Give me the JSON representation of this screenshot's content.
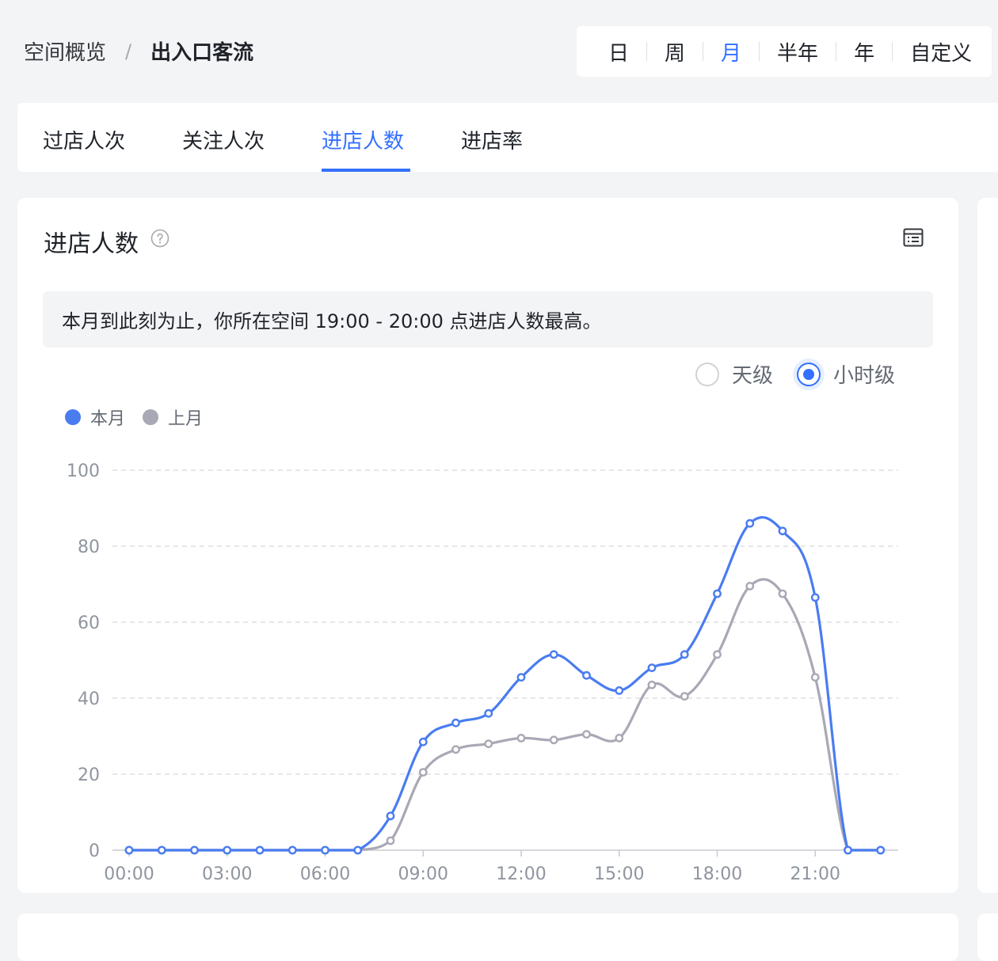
{
  "breadcrumb": {
    "parent": "空间概览",
    "separator": "/",
    "current": "出入口客流"
  },
  "range_switch": {
    "items": [
      "日",
      "周",
      "月",
      "半年",
      "年",
      "自定义"
    ],
    "active": "月"
  },
  "tabs": {
    "items": [
      "过店人次",
      "关注人次",
      "进店人数",
      "进店率"
    ],
    "active": "进店人数"
  },
  "card": {
    "title": "进店人数",
    "help_icon": "question-circle-icon",
    "table_icon": "table-view-icon",
    "insight": "本月到此刻为止，你所在空间 19:00 - 20:00 点进店人数最高。",
    "granularity": {
      "options": [
        "天级",
        "小时级"
      ],
      "selected": "小时级"
    }
  },
  "colors": {
    "accent": "#3370ff",
    "this_month": "#4a7cf0",
    "last_month": "#a9a8b5",
    "grid": "#dcdfe3",
    "axis_text": "#8f959e"
  },
  "chart_data": {
    "type": "line",
    "title": "",
    "xlabel": "",
    "ylabel": "",
    "ylim": [
      0,
      100
    ],
    "yticks": [
      0,
      20,
      40,
      60,
      80,
      100
    ],
    "x": [
      "00:00",
      "01:00",
      "02:00",
      "03:00",
      "04:00",
      "05:00",
      "06:00",
      "07:00",
      "08:00",
      "09:00",
      "10:00",
      "11:00",
      "12:00",
      "13:00",
      "14:00",
      "15:00",
      "16:00",
      "17:00",
      "18:00",
      "19:00",
      "20:00",
      "21:00",
      "22:00",
      "23:00"
    ],
    "xticks": [
      "00:00",
      "03:00",
      "06:00",
      "09:00",
      "12:00",
      "15:00",
      "18:00",
      "21:00"
    ],
    "grid": "horizontal-dashed",
    "legend_position": "top-left",
    "series": [
      {
        "name": "本月",
        "color": "#4a7cf0",
        "values": [
          0,
          0,
          0,
          0,
          0,
          0,
          0,
          0,
          9,
          28.5,
          33.5,
          36,
          45.5,
          51.5,
          46,
          42,
          48,
          51.5,
          67.5,
          86,
          84,
          66.5,
          0,
          0
        ]
      },
      {
        "name": "上月",
        "color": "#a9a8b5",
        "values": [
          0,
          0,
          0,
          0,
          0,
          0,
          0,
          0,
          2.5,
          20.5,
          26.5,
          28,
          29.5,
          29,
          30.5,
          29.5,
          43.5,
          40.5,
          51.5,
          69.5,
          67.5,
          45.5,
          0,
          0
        ]
      }
    ]
  }
}
